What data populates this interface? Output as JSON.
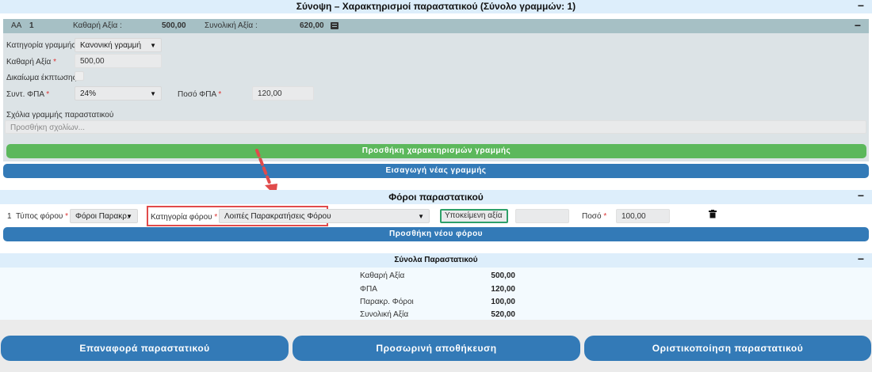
{
  "summary": {
    "title": "Σύνοψη – Χαρακτηρισμοί παραστατικού (Σύνολο γραμμών: 1)",
    "toggle": "−",
    "row": {
      "aa_label": "ΑΑ",
      "aa_value": "1",
      "net_label": "Καθαρή Αξία :",
      "net_value": "500,00",
      "total_label": "Συνολική Αξία :",
      "total_value": "620,00",
      "toggle": "−"
    },
    "category_label": "Κατηγορία γραμμής",
    "category_value": "Κανονική γραμμή",
    "net_field_label": "Καθαρή Αξία",
    "net_field_value": "500,00",
    "deduction_label": "Δικαίωμα έκπτωσης",
    "vat_rate_label": "Συντ. ΦΠΑ",
    "vat_rate_value": "24%",
    "vat_amount_label": "Ποσό ΦΠΑ",
    "vat_amount_value": "120,00",
    "comments_label": "Σχόλια γραμμής παραστατικού",
    "comments_placeholder": "Προσθήκη σχολίων...",
    "add_characterizations_button": "Προσθήκη χαρακτηρισμών γραμμής",
    "new_line_button": "Εισαγωγή νέας γραμμής",
    "required_mark": "*"
  },
  "taxes": {
    "title": "Φόροι παραστατικού",
    "toggle": "−",
    "row_number": "1",
    "tax_type_label": "Τύπος φόρου",
    "tax_type_value": "Φόροι Παρακρ.",
    "tax_category_label": "Κατηγορία φόρου",
    "tax_category_value": "Λοιπές Παρακρατήσεις Φόρου",
    "subject_value_placeholder": "Υποκείμενη αξία",
    "amount_label": "Ποσό",
    "amount_value": "100,00",
    "add_tax_button": "Προσθήκη νέου φόρου"
  },
  "totals": {
    "title": "Σύνολα Παραστατικού",
    "toggle": "−",
    "rows": [
      {
        "label": "Καθαρή Αξία",
        "value": "500,00"
      },
      {
        "label": "ΦΠΑ",
        "value": "120,00"
      },
      {
        "label": "Παρακρ. Φόροι",
        "value": "100,00"
      },
      {
        "label": "Συνολική Αξία",
        "value": "520,00"
      }
    ]
  },
  "actions": {
    "reset": "Επαναφορά παραστατικού",
    "save_draft": "Προσωρινή αποθήκευση",
    "finalize": "Οριστικοποίηση παραστατικού"
  },
  "colors": {
    "header_bg": "#ddeefb",
    "row_bar": "#a6c0c5",
    "green_button": "#5cb85c",
    "blue_button": "#337ab7",
    "highlight_red": "#e14b4b",
    "highlight_green": "#2ea06a"
  }
}
